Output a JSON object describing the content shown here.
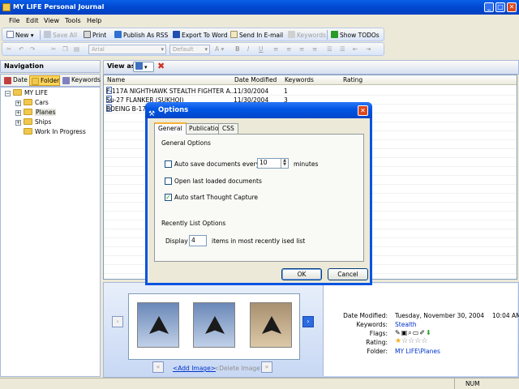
{
  "app": {
    "title": "MY LIFE Personal Journal"
  },
  "window_buttons": {
    "minimize": "_",
    "maximize": "□",
    "close": "✕"
  },
  "menu": [
    "File",
    "Edit",
    "View",
    "Tools",
    "Help"
  ],
  "toolbar1": {
    "new": "New",
    "save_all": "Save All",
    "print": "Print",
    "publish_rss": "Publish As RSS",
    "export_word": "Export To Word",
    "send_email": "Send In E-mail",
    "keywords": "Keywords",
    "show_todos": "Show TODOs"
  },
  "toolbar2": {
    "font": "Arial",
    "size": "Default",
    "bold": "B",
    "italic": "I",
    "underline": "U"
  },
  "nav": {
    "title": "Navigation",
    "tabs": [
      "Date",
      "Folder",
      "Keywords"
    ],
    "tree": {
      "root": "MY LIFE",
      "children": [
        "Cars",
        "Planes",
        "Ships",
        "Work In Progress"
      ]
    }
  },
  "view_as": {
    "label": "View as:"
  },
  "list": {
    "columns": [
      "Name",
      "Date Modified",
      "Keywords",
      "Rating"
    ],
    "rows": [
      {
        "name": "F-117A NIGHTHAWK STEALTH FIGHTER A...",
        "date": "11/30/2004",
        "keywords": "1"
      },
      {
        "name": "Su-27 FLANKER (SUKHOI)",
        "date": "11/30/2004",
        "keywords": "3"
      },
      {
        "name": "BOEING B-17",
        "date": "",
        "keywords": ""
      }
    ]
  },
  "images": {
    "add": "<Add Image>",
    "delete": "<Delete Image>"
  },
  "properties": {
    "date_modified_label": "Date Modified:",
    "date_modified": "Tuesday, November 30, 2004",
    "time": "10:04 AM",
    "keywords_label": "Keywords:",
    "keywords": "Stealth",
    "flags_label": "Flags:",
    "rating_label": "Rating:",
    "rating": 1,
    "rating_max": 5,
    "folder_label": "Folder:",
    "folder": "MY LIFE\\Planes"
  },
  "status": {
    "num": "NUM"
  },
  "dialog": {
    "title": "Options",
    "tabs": [
      "General",
      "Publication",
      "CSS"
    ],
    "section1": "General Options",
    "auto_save_label": "Auto save documents every:",
    "auto_save_checked": false,
    "auto_save_value": "10",
    "minutes": "minutes",
    "open_last_label": "Open last loaded documents",
    "open_last_checked": false,
    "auto_start_label": "Auto start Thought Capture",
    "auto_start_checked": true,
    "section2": "Recently List Options",
    "display_label": "Display",
    "display_value": "4",
    "display_suffix": "items in most recently ised list",
    "ok": "OK",
    "cancel": "Cancel"
  },
  "colors": {
    "titlebar": "#0054e3",
    "accent": "#f7b236",
    "link": "#0033cc"
  }
}
